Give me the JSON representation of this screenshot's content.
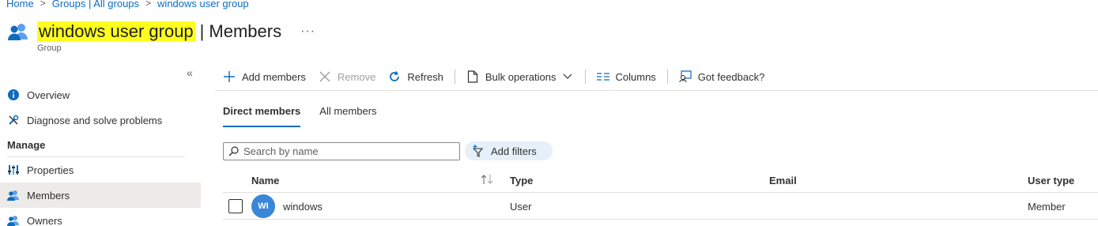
{
  "breadcrumb": [
    "Home",
    "Groups | All groups",
    "windows user group"
  ],
  "header": {
    "title_highlight": "windows user group",
    "title_suffix": "Members",
    "subtitle": "Group",
    "more": "···"
  },
  "collapse_glyph": "«",
  "nav": {
    "items_top": [
      {
        "label": "Overview",
        "icon": "info-icon"
      },
      {
        "label": "Diagnose and solve problems",
        "icon": "wrench-icon"
      }
    ],
    "section": "Manage",
    "items_manage": [
      {
        "label": "Properties",
        "icon": "properties-icon"
      },
      {
        "label": "Members",
        "icon": "members-icon",
        "active": true
      },
      {
        "label": "Owners",
        "icon": "owners-icon"
      }
    ]
  },
  "toolbar": {
    "add": "Add members",
    "remove": "Remove",
    "refresh": "Refresh",
    "bulk": "Bulk operations",
    "columns": "Columns",
    "feedback": "Got feedback?"
  },
  "tabs": [
    "Direct members",
    "All members"
  ],
  "search": {
    "placeholder": "Search by name"
  },
  "filters": {
    "label": "Add filters"
  },
  "table": {
    "columns": [
      "Name",
      "Type",
      "Email",
      "User type"
    ],
    "rows": [
      {
        "initials": "WI",
        "name": "windows",
        "type": "User",
        "email": "",
        "user_type": "Member"
      }
    ]
  },
  "colors": {
    "accent": "#0f6cbd",
    "highlight": "#ffff1f",
    "avatar": "#3a86d8",
    "active_nav": "#edebe9"
  }
}
